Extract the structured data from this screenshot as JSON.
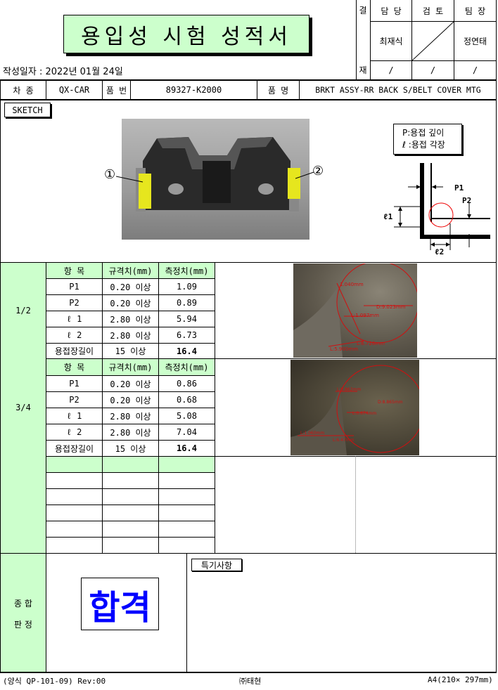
{
  "title": "용입성 시험 성적서",
  "date_line": "작성일자 : 2022년 01월 24일",
  "approval": {
    "side_top": "결",
    "side_bottom": "재",
    "headers": [
      "담 당",
      "검 토",
      "팀 장"
    ],
    "signatures": [
      "최재식",
      "",
      "정연태"
    ],
    "dates": [
      "/",
      "/",
      "/"
    ]
  },
  "info": {
    "vehicle_label": "차 종",
    "vehicle_value": "QX-CAR",
    "part_no_label": "품 번",
    "part_no_value": "89327-K2000",
    "part_name_label": "품 명",
    "part_name_value": "BRKT ASSY-RR BACK S/BELT COVER MTG"
  },
  "sketch": {
    "label": "SKETCH",
    "marker_1": "①",
    "marker_2": "②",
    "legend_p": "P:용접 깊이",
    "legend_l": "ℓ :용접 각장",
    "dim_p1": "P1",
    "dim_p2": "P2",
    "dim_l1": "ℓ1",
    "dim_l2": "ℓ2"
  },
  "table_headers": [
    "항  목",
    "규격치(mm)",
    "측정치(mm)"
  ],
  "sections": [
    {
      "label": "1/2",
      "rows": [
        {
          "item": "P1",
          "spec": "0.20 이상",
          "value": "1.09"
        },
        {
          "item": "P2",
          "spec": "0.20 이상",
          "value": "0.89"
        },
        {
          "item": "ℓ 1",
          "spec": "2.80 이상",
          "value": "5.94"
        },
        {
          "item": "ℓ 2",
          "spec": "2.80 이상",
          "value": "6.73"
        },
        {
          "item": "용접장길이",
          "spec": "15 이상",
          "value": "16.4"
        }
      ]
    },
    {
      "label": "3/4",
      "rows": [
        {
          "item": "P1",
          "spec": "0.20 이상",
          "value": "0.86"
        },
        {
          "item": "P2",
          "spec": "0.20 이상",
          "value": "0.68"
        },
        {
          "item": "ℓ 1",
          "spec": "2.80 이상",
          "value": "5.08"
        },
        {
          "item": "ℓ 2",
          "spec": "2.80 이상",
          "value": "7.04"
        },
        {
          "item": "용접장길이",
          "spec": "15 이상",
          "value": "16.4"
        }
      ]
    }
  ],
  "micro_labels_1": [
    "1.040mm",
    "D:9.023mm",
    "L:1.097mm",
    "L:6.726mm",
    "L:5.900mm"
  ],
  "micro_labels_2": [
    "L:0.862mm",
    "D:8.865mm",
    "L:0.674mm",
    "L:1.060mm",
    "L:6.47mm"
  ],
  "judgement": {
    "label_line1": "종 합",
    "label_line2": "판 정",
    "result": "합격",
    "remarks_label": "특기사항"
  },
  "footer": {
    "form_no": "(양식 QP-101-09) Rev:00",
    "company": "㈜태현",
    "paper": "A4(210× 297mm)"
  }
}
